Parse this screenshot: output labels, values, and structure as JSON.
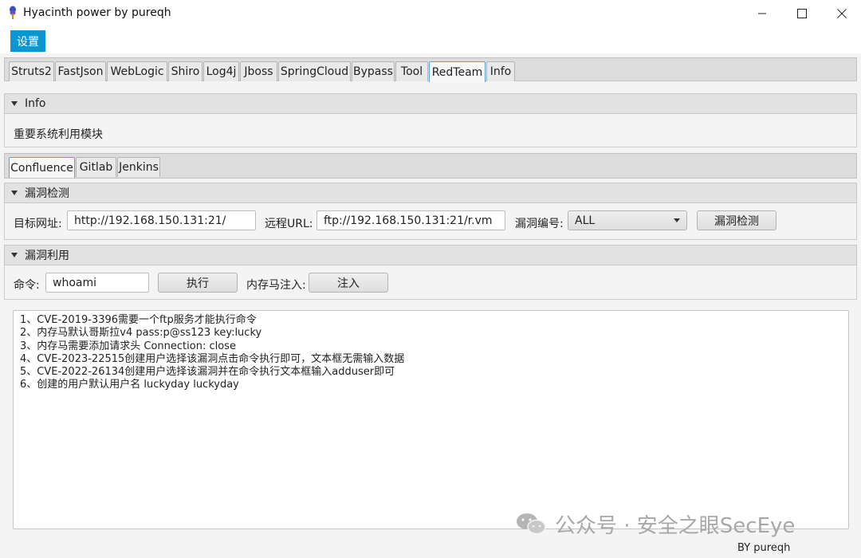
{
  "window": {
    "title": "Hyacinth power by pureqh",
    "controls": [
      "minimize",
      "maximize",
      "close"
    ]
  },
  "menu": {
    "settings_label": "设置"
  },
  "main_tabs": [
    {
      "label": "Struts2"
    },
    {
      "label": "FastJson"
    },
    {
      "label": "WebLogic"
    },
    {
      "label": "Shiro"
    },
    {
      "label": "Log4j"
    },
    {
      "label": "Jboss"
    },
    {
      "label": "SpringCloud"
    },
    {
      "label": "Bypass"
    },
    {
      "label": "Tool"
    },
    {
      "label": "RedTeam",
      "active": true
    },
    {
      "label": "Info"
    }
  ],
  "info_section": {
    "header": "Info",
    "text": "重要系统利用模块"
  },
  "sub_tabs": [
    {
      "label": "Confluence",
      "active": true
    },
    {
      "label": "Gitlab"
    },
    {
      "label": "Jenkins"
    }
  ],
  "detect_section": {
    "header": "漏洞检测",
    "target_label": "目标网址:",
    "target_value": "http://192.168.150.131:21/",
    "remote_label": "远程URL:",
    "remote_value": "ftp://192.168.150.131:21/r.vm",
    "vuln_id_label": "漏洞编号:",
    "vuln_id_value": "ALL",
    "detect_button": "漏洞检测"
  },
  "exploit_section": {
    "header": "漏洞利用",
    "cmd_label": "命令:",
    "cmd_value": "whoami",
    "exec_button": "执行",
    "memshell_label": "内存马注入:",
    "inject_button": "注入"
  },
  "output_lines": [
    "1、CVE-2019-3396需要一个ftp服务才能执行命令",
    "2、内存马默认哥斯拉v4 pass:p@ss123 key:lucky",
    "3、内存马需要添加请求头 Connection: close",
    "4、CVE-2023-22515创建用户选择该漏洞点击命令执行即可，文本框无需输入数据",
    "5、CVE-2022-26134创建用户选择该漏洞并在命令执行文本框输入adduser即可",
    "6、创建的用户默认用户名 luckyday luckyday"
  ],
  "watermark": "公众号 · 安全之眼SecEye",
  "footer": "BY   pureqh",
  "colors": {
    "accent": "#0b96cf",
    "active_tab_border": "#5aa7d6"
  }
}
